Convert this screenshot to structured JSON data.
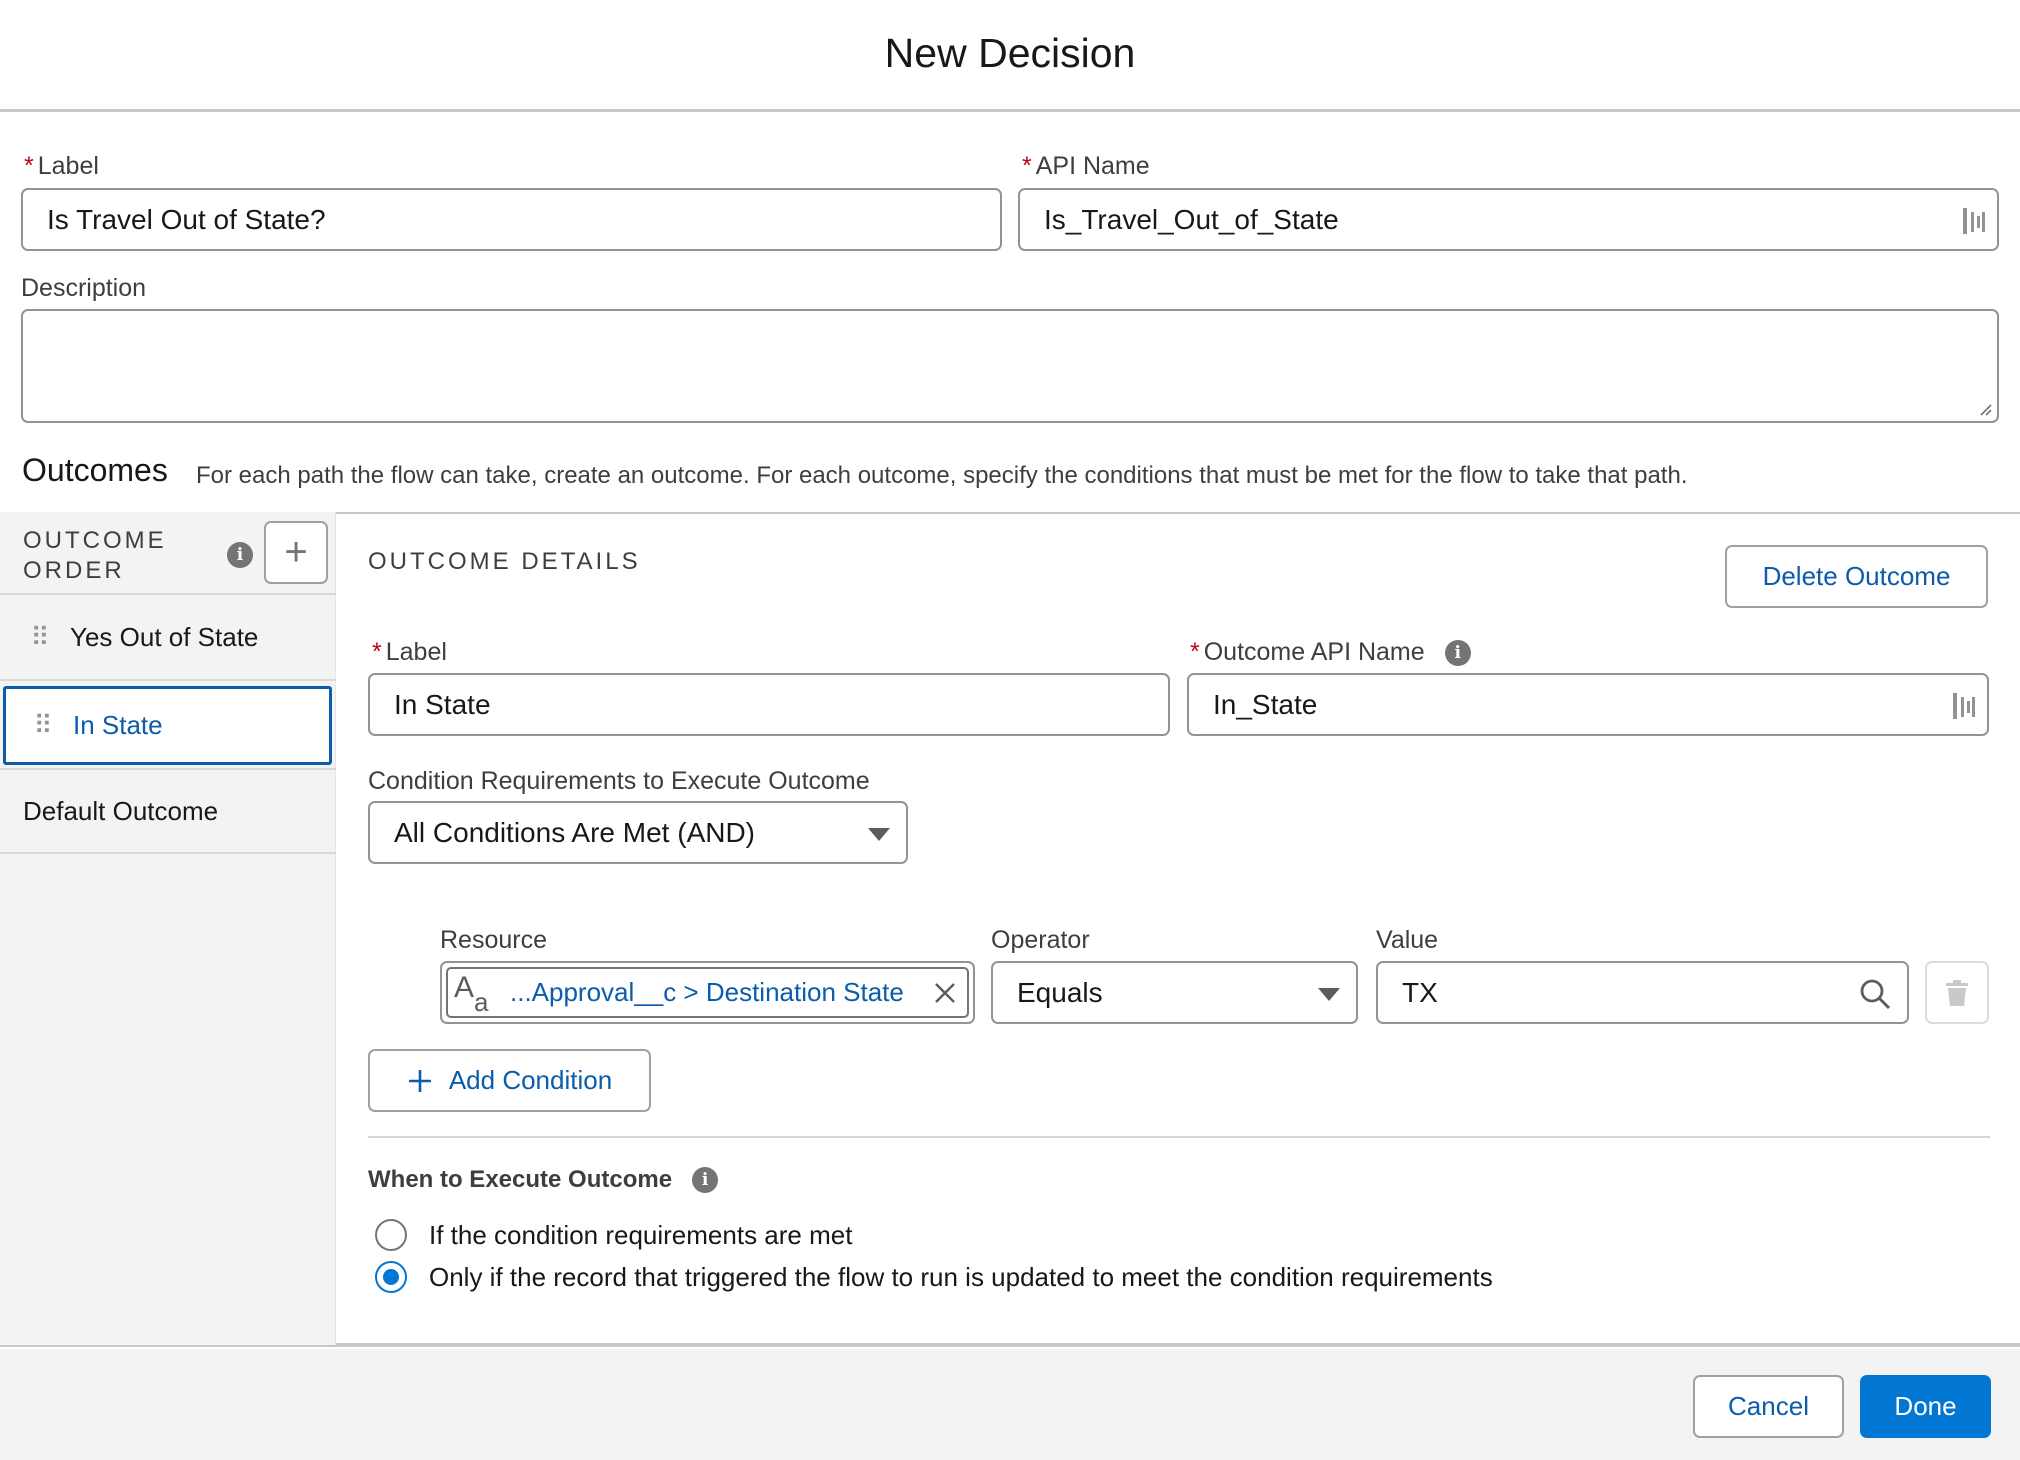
{
  "header": {
    "title": "New Decision"
  },
  "form": {
    "label_label": "Label",
    "label_value": "Is Travel Out of State?",
    "api_name_label": "API Name",
    "api_name_value": "Is_Travel_Out_of_State",
    "description_label": "Description",
    "description_value": "",
    "required_mark": "*"
  },
  "outcomes": {
    "title": "Outcomes",
    "description": "For each path the flow can take, create an outcome. For each outcome, specify the conditions that must be met for the flow to take that path."
  },
  "sidebar": {
    "header_line1": "OUTCOME",
    "header_line2": "ORDER",
    "add_symbol": "+",
    "items": [
      {
        "label": "Yes Out of State",
        "selected": false,
        "draggable": true
      },
      {
        "label": "In State",
        "selected": true,
        "draggable": true
      },
      {
        "label": "Default Outcome",
        "selected": false,
        "draggable": false
      }
    ]
  },
  "details": {
    "heading": "OUTCOME DETAILS",
    "delete_button": "Delete Outcome",
    "label_label": "Label",
    "label_value": "In State",
    "api_name_label": "Outcome API Name",
    "api_name_value": "In_State",
    "condition_req_label": "Condition Requirements to Execute Outcome",
    "condition_req_value": "All Conditions Are Met (AND)"
  },
  "condition": {
    "resource_label": "Resource",
    "resource_value": "...Approval__c > Destination State",
    "operator_label": "Operator",
    "operator_value": "Equals",
    "value_label": "Value",
    "value_value": "TX",
    "add_condition_button": "Add Condition"
  },
  "when_to_execute": {
    "heading": "When to Execute Outcome",
    "options": [
      {
        "label": "If the condition requirements are met",
        "selected": false
      },
      {
        "label": "Only if the record that triggered the flow to run is updated to meet the condition requirements",
        "selected": true
      }
    ]
  },
  "footer": {
    "cancel_button": "Cancel",
    "done_button": "Done"
  },
  "colors": {
    "brand": "#0176d3",
    "link": "#0b5cab",
    "required": "#ba0517"
  }
}
